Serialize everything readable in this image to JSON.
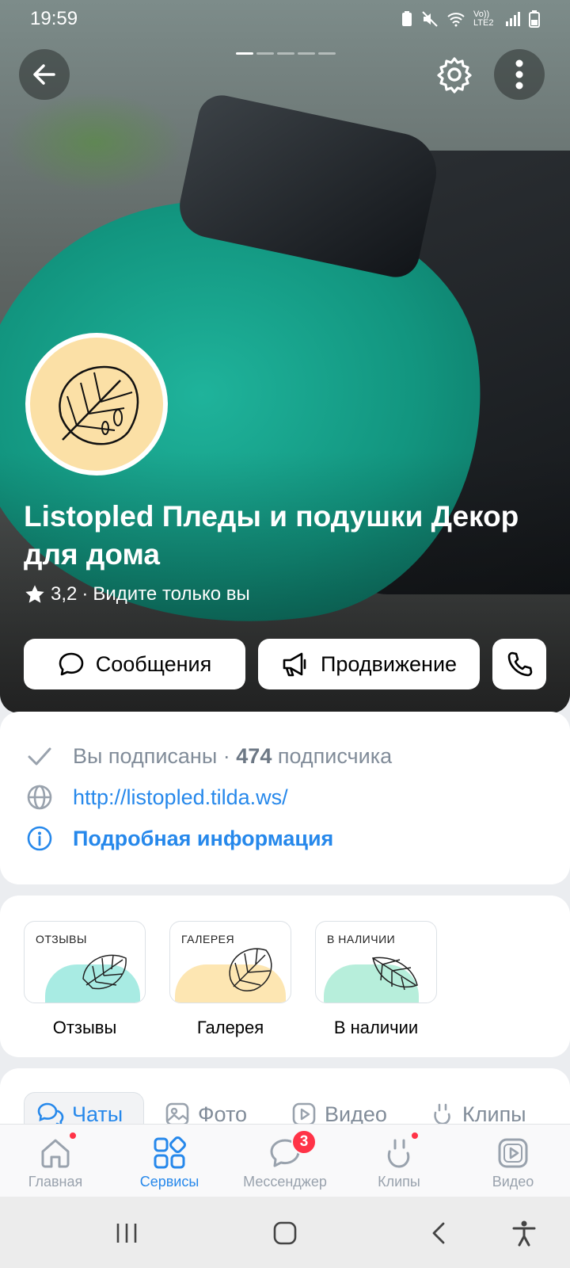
{
  "status_bar": {
    "time": "19:59",
    "indicators": [
      "battery-saver-icon",
      "mute-icon",
      "wifi-icon",
      "volte-icon",
      "signal-icon",
      "battery-icon"
    ],
    "volte_text": "Vo)) LTE2"
  },
  "header": {
    "pager_count": 5,
    "pager_active": 1,
    "title": "Listopled Пледы и подушки Декор для дома",
    "rating": "3,2",
    "separator": "·",
    "visibility": "Видите только вы"
  },
  "actions": {
    "messages": "Сообщения",
    "promotion": "Продвижение",
    "call_icon": "phone-icon"
  },
  "info": {
    "subscribed": "Вы подписаны",
    "dot": "·",
    "subscribers_count": "474",
    "subscribers_label": "подписчика",
    "url": "http://listopled.tilda.ws/",
    "details": "Подробная информация"
  },
  "services": [
    {
      "tag": "ОТЗЫВЫ",
      "label": "Отзывы",
      "color": "#a8ebe3"
    },
    {
      "tag": "ГАЛЕРЕЯ",
      "label": "Галерея",
      "color": "#fde6b2"
    },
    {
      "tag": "В НАЛИЧИИ",
      "label": "В наличии",
      "color": "#b7eedb"
    }
  ],
  "tabs": [
    "Чаты",
    "Фото",
    "Видео",
    "Клипы"
  ],
  "bottom_nav": [
    {
      "label": "Главная",
      "active": false,
      "dot": true
    },
    {
      "label": "Сервисы",
      "active": true,
      "dot": false
    },
    {
      "label": "Мессенджер",
      "active": false,
      "badge": "3"
    },
    {
      "label": "Клипы",
      "active": false,
      "dot": true
    },
    {
      "label": "Видео",
      "active": false,
      "dot": false
    }
  ],
  "colors": {
    "accent": "#2688eb",
    "secondary_text": "#818c99",
    "badge": "#ff3347",
    "avatar_bg": "#fbe0a6"
  }
}
